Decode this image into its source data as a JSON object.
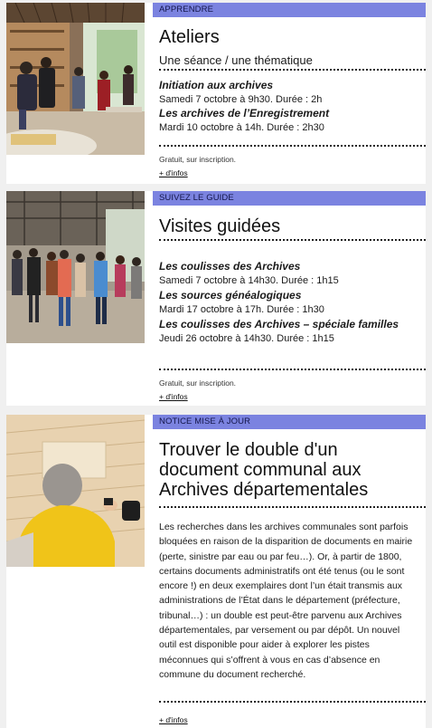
{
  "cards": [
    {
      "tag": "APPRENDRE",
      "title": "Ateliers",
      "subtitle": "Une séance / une thématique",
      "events": [
        {
          "title": "Initiation aux archives",
          "date": "Samedi 7 octobre à 9h30. Durée : 2h"
        },
        {
          "title": "Les archives de l’Enregistrement",
          "date": "Mardi 10 octobre à 14h. Durée : 2h30"
        }
      ],
      "note": "Gratuit, sur inscription.",
      "link": "+ d'infos"
    },
    {
      "tag": "SUIVEZ LE GUIDE",
      "title": "Visites guidées",
      "events": [
        {
          "title": "Les coulisses des Archives",
          "date": "Samedi 7 octobre à 14h30. Durée : 1h15"
        },
        {
          "title": "Les sources généalogiques",
          "date": "Mardi 17 octobre à 17h. Durée : 1h30"
        },
        {
          "title": "Les coulisses des Archives – spéciale familles",
          "date": "Jeudi 26 octobre à 14h30. Durée : 1h15"
        }
      ],
      "note": "Gratuit, sur inscription.",
      "link": "+ d'infos"
    },
    {
      "tag": "NOTICE MISE À JOUR",
      "title": "Trouver le double d'un document communal aux Archives départementales",
      "body": "Les recherches dans les archives communales sont parfois bloquées en raison de la disparition de documents en mairie (perte, sinistre par eau ou par feu…). Or, à partir de 1800, certains documents administratifs ont été tenus (ou le sont encore !) en deux exemplaires dont l’un était transmis aux administrations de l’État dans le département (préfecture, tribunal…) : un double est peut-être parvenu aux Archives départementales, par versement ou par dépôt. Un nouvel outil est disponible pour aider à explorer les pistes méconnues qui s’offrent à vous en cas d’absence en commune du document recherché.",
      "link": "+ d'infos"
    }
  ],
  "colors": {
    "tag_bg": "#7b83e0",
    "page_bg": "#f0f0f0"
  }
}
